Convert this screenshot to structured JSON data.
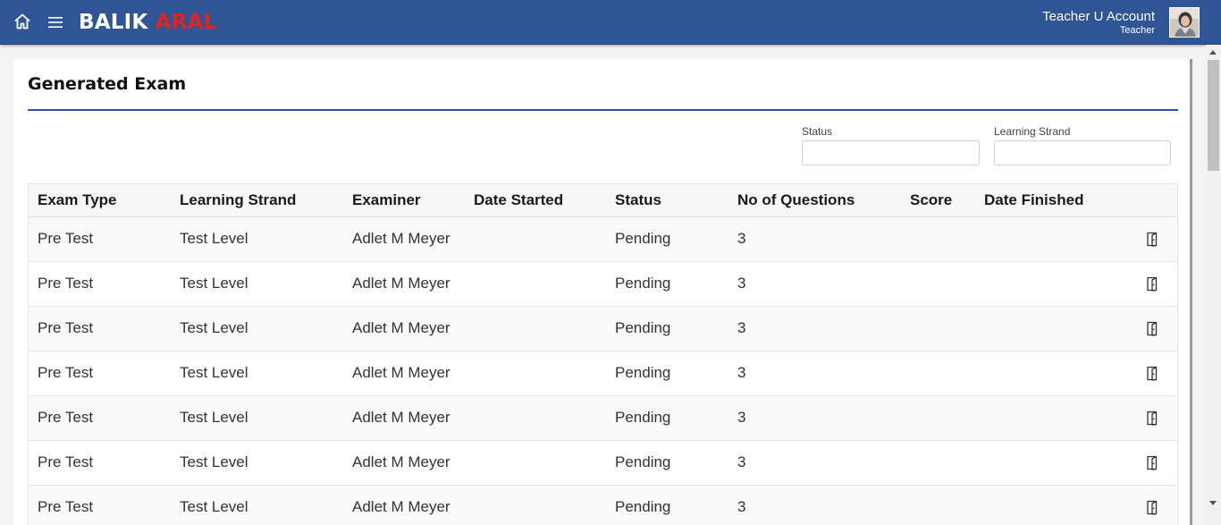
{
  "header": {
    "brand_part1": "BALIK",
    "brand_part2": "ARAL",
    "user_name": "Teacher U Account",
    "user_role": "Teacher",
    "icons": {
      "home": "home-icon",
      "menu": "hamburger-menu-icon"
    },
    "colors": {
      "bar": "#2f5597",
      "brand_accent": "#e52222"
    }
  },
  "page": {
    "title": "Generated Exam"
  },
  "filters": {
    "status_label": "Status",
    "status_value": "",
    "strand_label": "Learning Strand",
    "strand_value": ""
  },
  "table": {
    "headers": [
      "Exam Type",
      "Learning Strand",
      "Examiner",
      "Date Started",
      "Status",
      "No of Questions",
      "Score",
      "Date Finished"
    ],
    "rows": [
      [
        "Pre Test",
        "Test Level",
        "Adlet M Meyer",
        "",
        "Pending",
        "3",
        "",
        ""
      ],
      [
        "Pre Test",
        "Test Level",
        "Adlet M Meyer",
        "",
        "Pending",
        "3",
        "",
        ""
      ],
      [
        "Pre Test",
        "Test Level",
        "Adlet M Meyer",
        "",
        "Pending",
        "3",
        "",
        ""
      ],
      [
        "Pre Test",
        "Test Level",
        "Adlet M Meyer",
        "",
        "Pending",
        "3",
        "",
        ""
      ],
      [
        "Pre Test",
        "Test Level",
        "Adlet M Meyer",
        "",
        "Pending",
        "3",
        "",
        ""
      ],
      [
        "Pre Test",
        "Test Level",
        "Adlet M Meyer",
        "",
        "Pending",
        "3",
        "",
        ""
      ],
      [
        "Pre Test",
        "Test Level",
        "Adlet M Meyer",
        "",
        "Pending",
        "3",
        "",
        ""
      ]
    ],
    "row_action_icon": "open-exam-icon"
  }
}
